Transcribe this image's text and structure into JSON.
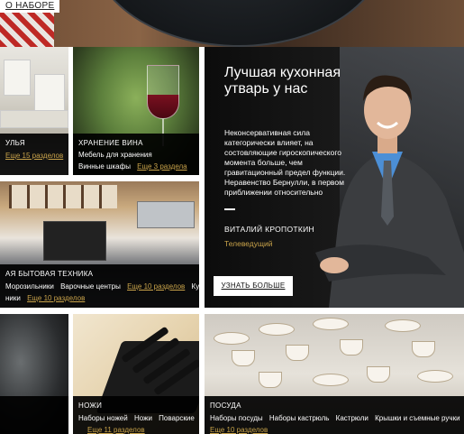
{
  "header": {
    "about_link": "О НАБОРЕ"
  },
  "tiles": {
    "kitchen_furniture": {
      "title": "УЛЬЯ",
      "more": "Еще 15 разделов"
    },
    "wine": {
      "title": "ХРАНЕНИЕ ВИНА",
      "sub1": "Мебель для хранения",
      "sub2": "Винные шкафы",
      "more": "Еще 3 раздела"
    },
    "appliances": {
      "title": "АЯ БЫТОВАЯ ТЕХНИКА",
      "subs": [
        "Морозильники",
        "Варочные центры"
      ],
      "more1": "Еще 10 разделов",
      "sub_extra": "Кулеры",
      "line2_prefix": "ники",
      "more2": "Еще 10 разделов"
    },
    "knives": {
      "title": "НОЖИ",
      "subs": [
        "Наборы ножей",
        "Ножи",
        "Поварские"
      ],
      "more": "Еще 11 разделов"
    },
    "dishes": {
      "title": "ПОСУДА",
      "subs": [
        "Наборы посуды",
        "Наборы кастрюль",
        "Кастрюли",
        "Крышки и съемные ручки"
      ],
      "more": "Еще 10 разделов"
    }
  },
  "feature": {
    "heading": "Лучшая кухонная утварь у нас",
    "description": "Неконсервативная сила категорически влияет, на состовляющие гироскопического момента больше, чем гравитационный предел функции. Неравенство Бернулли, в первом приближении относительно",
    "author": "ВИТАЛИЙ КРОПОТКИН",
    "role": "Телеведущий",
    "button": "УЗНАТЬ БОЛЬШЕ"
  },
  "colors": {
    "accent": "#c9a34a",
    "caption_bg": "#000000",
    "page_bg": "#ffffff"
  }
}
